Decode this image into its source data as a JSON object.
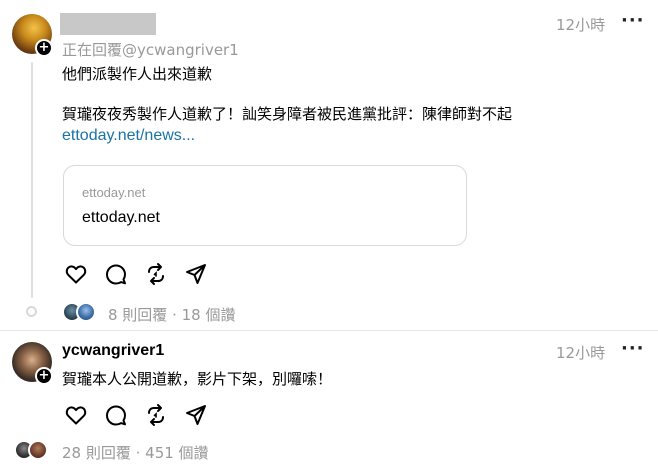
{
  "post1": {
    "reply_prefix": "正在回覆@ycwangriver1",
    "timestamp": "12小時",
    "more": "···",
    "line1": "他們派製作人出來道歉",
    "line2": "賀瓏夜夜秀製作人道歉了！訕笑身障者被民進黨批評：陳律師對不起",
    "link": "ettoday.net/news...",
    "card": {
      "domain_small": "ettoday.net",
      "domain_big": "ettoday.net"
    },
    "stats": "8 則回覆 · 18 個讚"
  },
  "post2": {
    "username": "ycwangriver1",
    "timestamp": "12小時",
    "more": "···",
    "text": "賀瓏本人公開道歉，影片下架，別囉嗦！",
    "stats": "28 則回覆 · 451 個讚"
  },
  "icons": [
    "heart-icon",
    "comment-icon",
    "repost-icon",
    "share-icon",
    "plus-icon"
  ],
  "colors": {
    "link": "#1a73a8",
    "muted": "#999999",
    "border": "#d9d9d9"
  }
}
